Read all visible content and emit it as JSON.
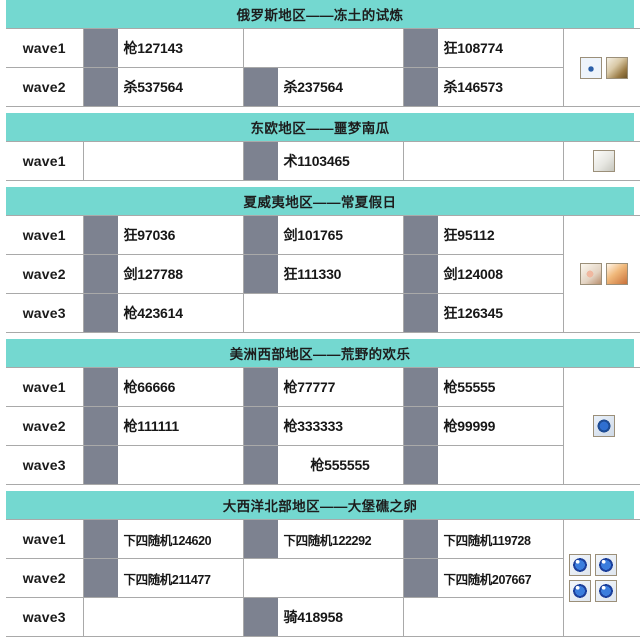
{
  "table": {
    "columns": [
      "wave",
      "slot1",
      "slot2",
      "slot3",
      "drops"
    ],
    "sections": [
      {
        "id": "russia",
        "title": "俄罗斯地区——冻土的试炼",
        "rows": [
          {
            "wave": "wave1",
            "slots": [
              {
                "label": "枪127143",
                "icon": "ice-beast-portrait"
              },
              {
                "label": "",
                "icon": ""
              },
              {
                "label": "狂108774",
                "icon": "blue-knight-portrait"
              }
            ]
          },
          {
            "wave": "wave2",
            "slots": [
              {
                "label": "杀537564",
                "icon": "dark-beast-portrait"
              },
              {
                "label": "杀237564",
                "icon": "dark-beast-portrait"
              },
              {
                "label": "杀146573",
                "icon": "dark-beast-portrait"
              }
            ]
          }
        ],
        "drops": [
          {
            "name": "snow-crystal-item",
            "art": "ic-snow",
            "wide": false
          },
          {
            "name": "bone-fang-item",
            "art": "ic-bone",
            "wide": false
          }
        ]
      },
      {
        "id": "eastern-europe",
        "title": "东欧地区——噩梦南瓜",
        "rows": [
          {
            "wave": "wave1",
            "slots": [
              {
                "label": "",
                "icon": ""
              },
              {
                "label": "术1103465",
                "icon": "pumpkin-witch-portrait"
              },
              {
                "label": "",
                "icon": ""
              }
            ]
          }
        ],
        "drops": [
          {
            "name": "scroll-page-item",
            "art": "ic-page",
            "wide": false
          }
        ]
      },
      {
        "id": "hawaii",
        "title": "夏威夷地区——常夏假日",
        "rows": [
          {
            "wave": "wave1",
            "slots": [
              {
                "label": "狂97036",
                "icon": "red-lobster-portrait"
              },
              {
                "label": "剑101765",
                "icon": "crab-portrait"
              },
              {
                "label": "狂95112",
                "icon": "red-lobster-portrait"
              }
            ]
          },
          {
            "wave": "wave2",
            "slots": [
              {
                "label": "剑127788",
                "icon": "crab-portrait"
              },
              {
                "label": "狂111330",
                "icon": "red-lobster-portrait"
              },
              {
                "label": "剑124008",
                "icon": "crab-portrait"
              }
            ]
          },
          {
            "wave": "wave3",
            "slots": [
              {
                "label": "枪423614",
                "icon": "blonde-rider-portrait"
              },
              {
                "label": "",
                "icon": ""
              },
              {
                "label": "狂126345",
                "icon": "red-lobster-portrait"
              }
            ]
          }
        ],
        "drops": [
          {
            "name": "crab-claw-item",
            "art": "ic-claw",
            "wide": false
          },
          {
            "name": "phoenix-feather-item",
            "art": "ic-feather",
            "wide": false
          }
        ]
      },
      {
        "id": "western-america",
        "title": "美洲西部地区——荒野的欢乐",
        "rows": [
          {
            "wave": "wave1",
            "slots": [
              {
                "label": "枪66666",
                "icon": "gold-pile-portrait"
              },
              {
                "label": "枪77777",
                "icon": "gold-pile-portrait"
              },
              {
                "label": "枪55555",
                "icon": "gold-pile-portrait"
              }
            ]
          },
          {
            "wave": "wave2",
            "slots": [
              {
                "label": "枪111111",
                "icon": "gold-pile-portrait"
              },
              {
                "label": "枪333333",
                "icon": "gold-pile-portrait"
              },
              {
                "label": "枪99999",
                "icon": "gold-pile-portrait"
              }
            ]
          },
          {
            "wave": "wave3",
            "slots": [
              {
                "label": "",
                "icon": "gold-pile-portrait"
              },
              {
                "label": "枪555555",
                "icon": "gold-pile-portrait",
                "center": true
              },
              {
                "label": "",
                "icon": "gold-pile-portrait"
              }
            ]
          }
        ],
        "drops": [
          {
            "name": "blue-gem-item",
            "art": "ic-coin",
            "wide": false
          }
        ]
      },
      {
        "id": "north-atlantic",
        "title": "大西洋北部地区——大堡礁之卵",
        "rows": [
          {
            "wave": "wave1",
            "slots": [
              {
                "label": "下四随机124620",
                "icon": "crustacean-portrait",
                "small": true
              },
              {
                "label": "下四随机122292",
                "icon": "crustacean-portrait",
                "small": true
              },
              {
                "label": "下四随机119728",
                "icon": "crustacean-portrait",
                "small": true
              }
            ]
          },
          {
            "wave": "wave2",
            "slots": [
              {
                "label": "下四随机211477",
                "icon": "shark-portrait",
                "small": true
              },
              {
                "label": "",
                "icon": ""
              },
              {
                "label": "下四随机207667",
                "icon": "shark-portrait",
                "small": true
              }
            ]
          },
          {
            "wave": "wave3",
            "slots": [
              {
                "label": "",
                "icon": ""
              },
              {
                "label": "骑418958",
                "icon": "knight-portrait"
              },
              {
                "label": "",
                "icon": ""
              }
            ]
          }
        ],
        "drops": [
          {
            "name": "blue-orb-item",
            "art": "ic-orb",
            "wide": false
          },
          {
            "name": "blue-orb-item",
            "art": "ic-orb",
            "wide": false
          },
          {
            "name": "blue-orb-item",
            "art": "ic-orb",
            "wide": false
          },
          {
            "name": "blue-orb-item",
            "art": "ic-orb",
            "wide": false
          }
        ]
      }
    ]
  },
  "colors": {
    "band": "#74d8d0",
    "grid": "#a9a9a9",
    "text": "#171717",
    "background": "#ffffff"
  }
}
